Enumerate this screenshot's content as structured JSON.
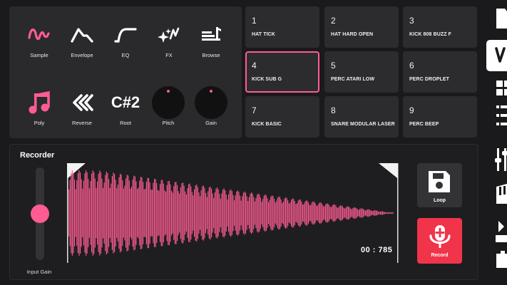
{
  "accent": "#ff5c93",
  "record_color": "#f0344a",
  "tools": [
    {
      "label": "Sample",
      "icon": "sample-wave-icon"
    },
    {
      "label": "Envelope",
      "icon": "envelope-icon"
    },
    {
      "label": "EQ",
      "icon": "eq-curve-icon"
    },
    {
      "label": "FX",
      "icon": "fx-sparkle-icon"
    },
    {
      "label": "Browse",
      "icon": "browse-list-icon"
    },
    {
      "label": "Poly",
      "icon": "music-note-icon"
    },
    {
      "label": "Reverse",
      "icon": "reverse-icon"
    },
    {
      "label": "Root",
      "value": "C#2"
    },
    {
      "label": "Pitch",
      "icon": "pitch-knob"
    },
    {
      "label": "Gain",
      "icon": "gain-knob"
    }
  ],
  "pads": [
    {
      "num": "1",
      "name": "HAT TICK"
    },
    {
      "num": "2",
      "name": "HAT HARD OPEN"
    },
    {
      "num": "3",
      "name": "KICK 808 BUZZ F"
    },
    {
      "num": "4",
      "name": "KICK SUB G",
      "selected": true
    },
    {
      "num": "5",
      "name": "PERC ATARI LOW"
    },
    {
      "num": "6",
      "name": "PERC DROPLET"
    },
    {
      "num": "7",
      "name": "KICK BASIC"
    },
    {
      "num": "8",
      "name": "SNARE MODULAR LASER"
    },
    {
      "num": "9",
      "name": "PERC BEEP"
    }
  ],
  "recorder": {
    "title": "Recorder",
    "input_gain_label": "Input Gain",
    "input_gain_level": 0.5,
    "timer": "00 : 785",
    "loop_label": "Loop",
    "record_label": "Record"
  },
  "sidebar_icons": [
    "file-icon",
    "waveform-tab-icon",
    "grid-icon",
    "list-icon",
    "sliders-icon",
    "piano-icon",
    "transport-icon",
    "settings-icon"
  ]
}
